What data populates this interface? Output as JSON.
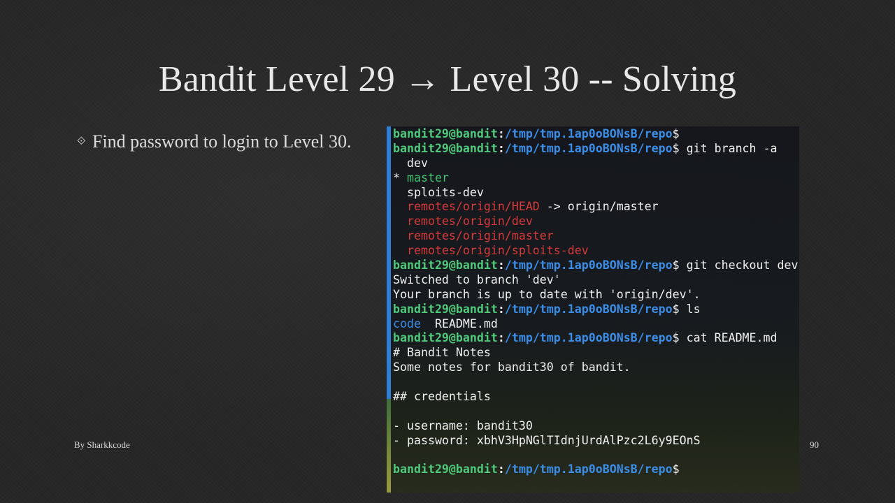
{
  "slide": {
    "title": "Bandit Level 29 → Level 30 -- Solving",
    "bullet_marker": "⟐",
    "bullet": "Find password to login to Level 30.",
    "footer": "By Sharkkcode",
    "page_number": "90"
  },
  "colors": {
    "background": "#262626",
    "user": "#4fc97b",
    "path": "#3b8ee8",
    "branch_current": "#41c270",
    "remote": "#d63a3a",
    "dir": "#3b8ee8"
  },
  "terminal": {
    "prompt_user": "bandit29@bandit",
    "prompt_colon": ":",
    "prompt_path": "/tmp/tmp.1ap0oBONsB/repo",
    "prompt_dollar": "$",
    "cmd_git_branch": " git branch -a",
    "branch_dev": "  dev",
    "branch_star": "* ",
    "branch_master": "master",
    "branch_sploits": "  sploits-dev",
    "remote_head": "remotes/origin/HEAD",
    "remote_head_arrow": " -> origin/master",
    "remote_dev": "remotes/origin/dev",
    "remote_master": "remotes/origin/master",
    "remote_sploits": "remotes/origin/sploits-dev",
    "cmd_checkout": " git checkout dev",
    "out_switched": "Switched to branch 'dev'",
    "out_uptodate": "Your branch is up to date with 'origin/dev'.",
    "cmd_ls": " ls",
    "ls_code": "code",
    "ls_readme": "  README.md",
    "cmd_cat": " cat README.md",
    "readme_heading": "# Bandit Notes",
    "readme_line": "Some notes for bandit30 of bandit.",
    "readme_creds": "## credentials",
    "readme_user": "- username: bandit30",
    "readme_pass": "- password: xbhV3HpNGlTIdnjUrdAlPzc2L6y9EOnS"
  }
}
